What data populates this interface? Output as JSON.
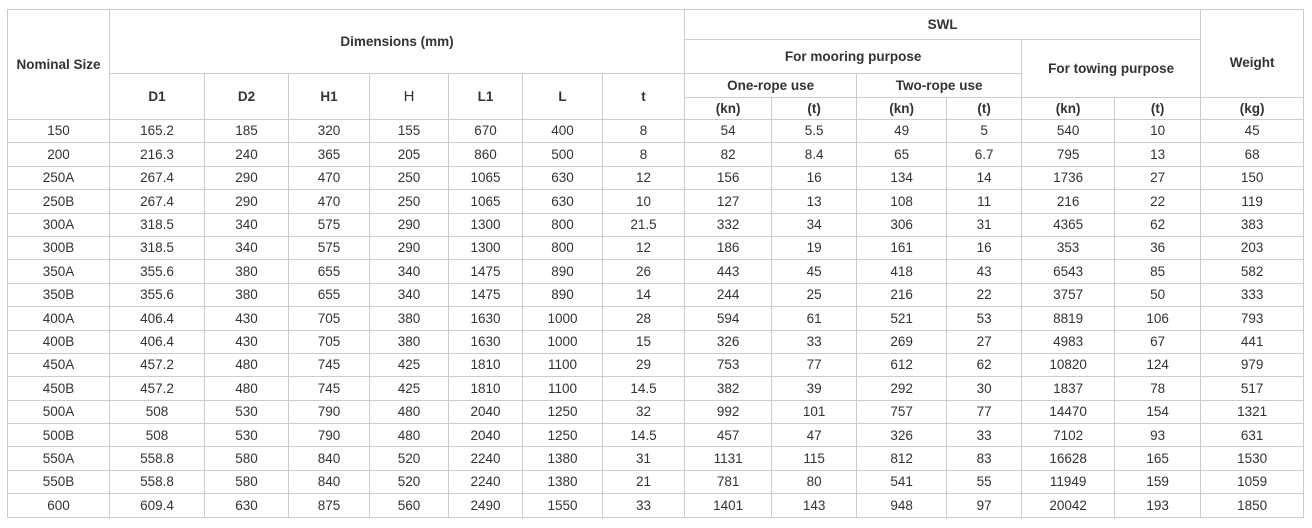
{
  "headers": {
    "nominal_size": "Nominal Size",
    "dimensions": "Dimensions (mm)",
    "swl": "SWL",
    "mooring": "For mooring purpose",
    "one_rope": "One-rope use",
    "two_rope": "Two-rope use",
    "towing": "For towing purpose",
    "weight": "Weight",
    "cols": [
      "D1",
      "D2",
      "H1",
      "H",
      "L1",
      "L",
      "t"
    ],
    "unit_kn": "(kn)",
    "unit_t": "(t)",
    "unit_kg": "(kg)"
  },
  "rows": [
    [
      "150",
      "165.2",
      "185",
      "320",
      "155",
      "670",
      "400",
      "8",
      "54",
      "5.5",
      "49",
      "5",
      "540",
      "10",
      "45"
    ],
    [
      "200",
      "216.3",
      "240",
      "365",
      "205",
      "860",
      "500",
      "8",
      "82",
      "8.4",
      "65",
      "6.7",
      "795",
      "13",
      "68"
    ],
    [
      "250A",
      "267.4",
      "290",
      "470",
      "250",
      "1065",
      "630",
      "12",
      "156",
      "16",
      "134",
      "14",
      "1736",
      "27",
      "150"
    ],
    [
      "250B",
      "267.4",
      "290",
      "470",
      "250",
      "1065",
      "630",
      "10",
      "127",
      "13",
      "108",
      "11",
      "216",
      "22",
      "119"
    ],
    [
      "300A",
      "318.5",
      "340",
      "575",
      "290",
      "1300",
      "800",
      "21.5",
      "332",
      "34",
      "306",
      "31",
      "4365",
      "62",
      "383"
    ],
    [
      "300B",
      "318.5",
      "340",
      "575",
      "290",
      "1300",
      "800",
      "12",
      "186",
      "19",
      "161",
      "16",
      "353",
      "36",
      "203"
    ],
    [
      "350A",
      "355.6",
      "380",
      "655",
      "340",
      "1475",
      "890",
      "26",
      "443",
      "45",
      "418",
      "43",
      "6543",
      "85",
      "582"
    ],
    [
      "350B",
      "355.6",
      "380",
      "655",
      "340",
      "1475",
      "890",
      "14",
      "244",
      "25",
      "216",
      "22",
      "3757",
      "50",
      "333"
    ],
    [
      "400A",
      "406.4",
      "430",
      "705",
      "380",
      "1630",
      "1000",
      "28",
      "594",
      "61",
      "521",
      "53",
      "8819",
      "106",
      "793"
    ],
    [
      "400B",
      "406.4",
      "430",
      "705",
      "380",
      "1630",
      "1000",
      "15",
      "326",
      "33",
      "269",
      "27",
      "4983",
      "67",
      "441"
    ],
    [
      "450A",
      "457.2",
      "480",
      "745",
      "425",
      "1810",
      "1100",
      "29",
      "753",
      "77",
      "612",
      "62",
      "10820",
      "124",
      "979"
    ],
    [
      "450B",
      "457.2",
      "480",
      "745",
      "425",
      "1810",
      "1100",
      "14.5",
      "382",
      "39",
      "292",
      "30",
      "1837",
      "78",
      "517"
    ],
    [
      "500A",
      "508",
      "530",
      "790",
      "480",
      "2040",
      "1250",
      "32",
      "992",
      "101",
      "757",
      "77",
      "14470",
      "154",
      "1321"
    ],
    [
      "500B",
      "508",
      "530",
      "790",
      "480",
      "2040",
      "1250",
      "14.5",
      "457",
      "47",
      "326",
      "33",
      "7102",
      "93",
      "631"
    ],
    [
      "550A",
      "558.8",
      "580",
      "840",
      "520",
      "2240",
      "1380",
      "31",
      "1131",
      "115",
      "812",
      "83",
      "16628",
      "165",
      "1530"
    ],
    [
      "550B",
      "558.8",
      "580",
      "840",
      "520",
      "2240",
      "1380",
      "21",
      "781",
      "80",
      "541",
      "55",
      "11949",
      "159",
      "1059"
    ],
    [
      "600",
      "609.4",
      "630",
      "875",
      "560",
      "2490",
      "1550",
      "33",
      "1401",
      "143",
      "948",
      "97",
      "20042",
      "193",
      "1850"
    ]
  ]
}
